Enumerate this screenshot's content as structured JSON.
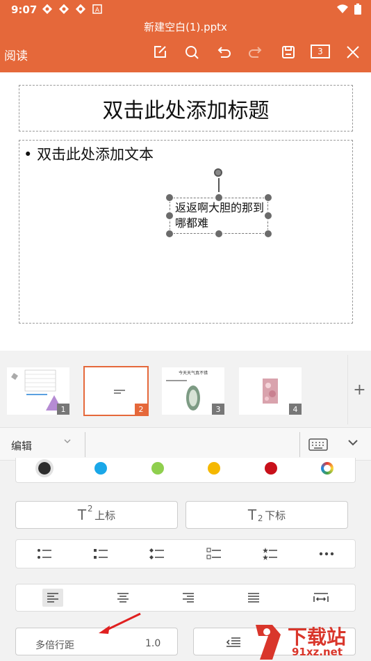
{
  "status_bar": {
    "time": "9:07"
  },
  "header": {
    "file_title": "新建空白(1).pptx",
    "read_label": "阅读",
    "page_count": "3"
  },
  "slide": {
    "title_placeholder": "双击此处添加标题",
    "body_placeholder": "双击此处添加文本",
    "selected_text": "返返啊大胆的那到哪都难"
  },
  "thumbnails": {
    "items": [
      {
        "number": "1"
      },
      {
        "number": "2",
        "active": true
      },
      {
        "number": "3",
        "caption": "今天天气真不错"
      },
      {
        "number": "4"
      }
    ],
    "add_label": "+"
  },
  "edit_bar": {
    "mode_label": "编辑"
  },
  "colors": {
    "accent": "#e5683a",
    "swatches": [
      "#2d2d2d",
      "#1aa7e8",
      "#8fcf4e",
      "#f5b800",
      "#c8101a",
      "#multicolor"
    ]
  },
  "text_format": {
    "superscript_label": "上标",
    "subscript_label": "下标"
  },
  "line_spacing": {
    "label": "多倍行距",
    "value": "1.0"
  },
  "watermark": {
    "brand": "下载站",
    "url": "91xz.net"
  }
}
